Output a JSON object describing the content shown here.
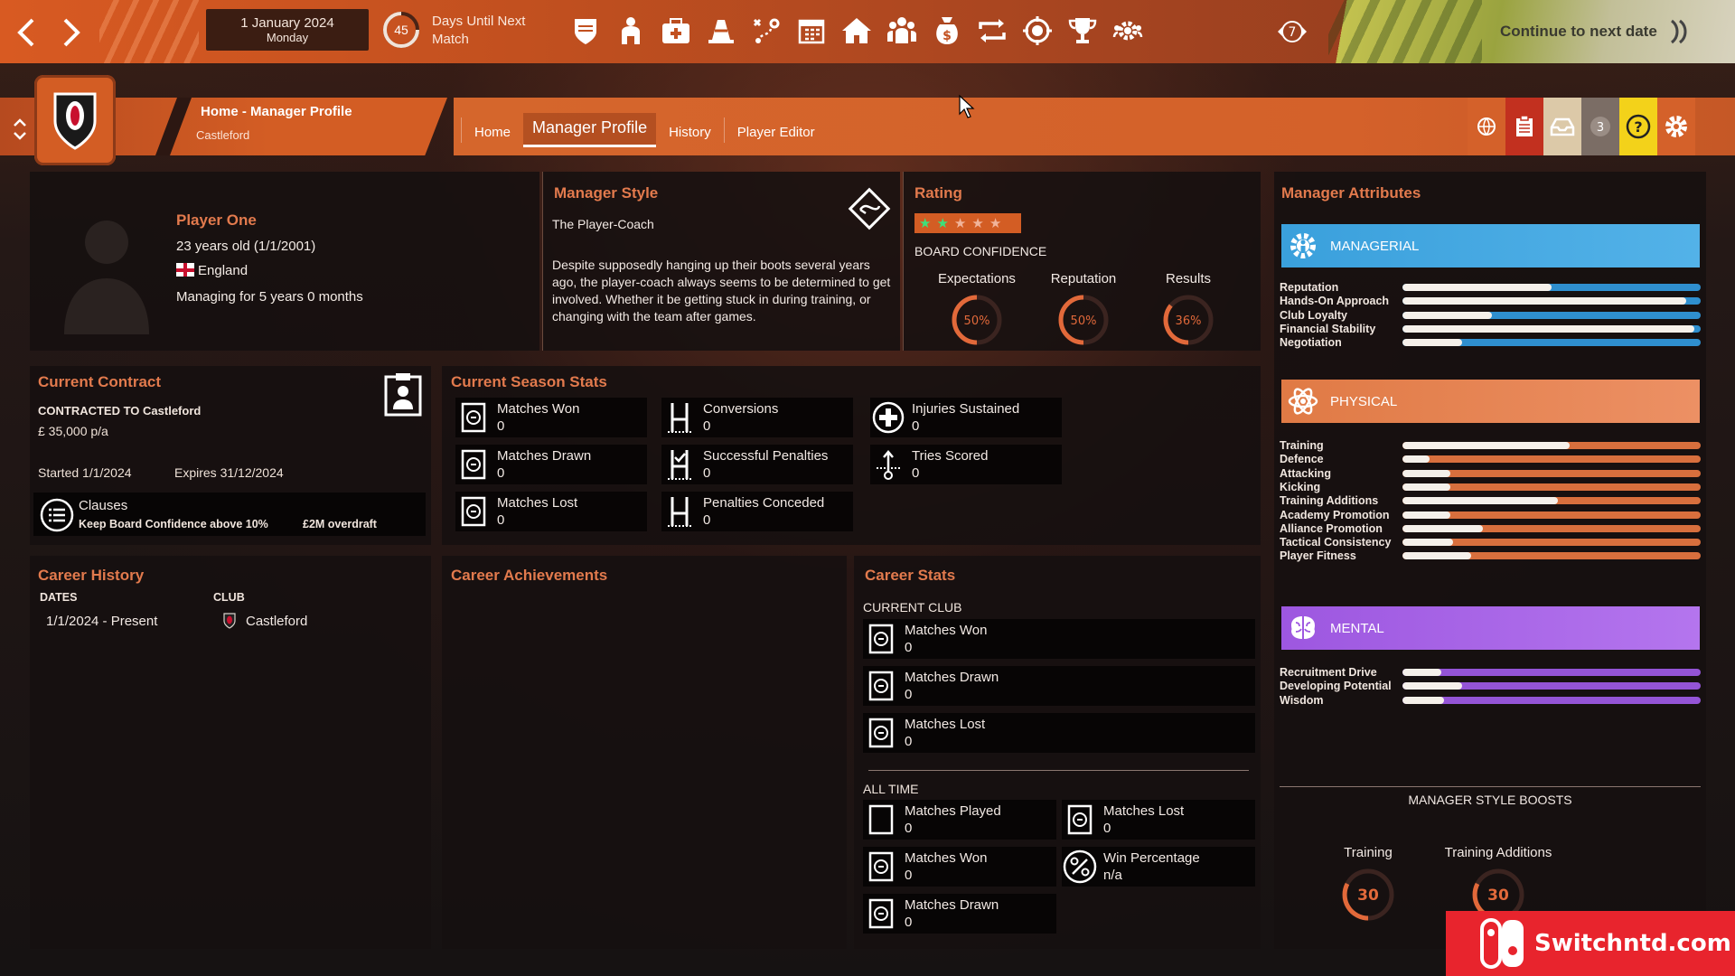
{
  "topbar": {
    "date": "1 January 2024",
    "weekday": "Monday",
    "days_count": "45",
    "days_label": "Days Until Next Match",
    "seven_badge": "7",
    "continue_label": "Continue to next date",
    "icons": [
      "shield-icon",
      "squad-icon",
      "medical-icon",
      "training-cone-icon",
      "tactics-icon",
      "calendar-icon",
      "home-icon",
      "staff-icon",
      "finance-icon",
      "transfer-icon",
      "scouting-icon",
      "trophy-icon",
      "settings-group-icon"
    ]
  },
  "breadcrumb": {
    "title": "Home - Manager Profile",
    "club": "Castleford"
  },
  "tabs": [
    "Home",
    "Manager Profile",
    "History",
    "Player Editor"
  ],
  "active_tab": "Manager Profile",
  "toolbar": {
    "notifications": "3"
  },
  "profile": {
    "name": "Player One",
    "age": "23 years old (1/1/2001)",
    "nation": "England",
    "tenure": "Managing for 5 years 0 months"
  },
  "manager_style": {
    "title": "Manager Style",
    "name": "The Player-Coach",
    "description": "Despite supposedly hanging up their boots several years ago, the player-coach always seems to be determined to get involved. Whether it be getting stuck in during training, or changing with the team after games."
  },
  "rating": {
    "title": "Rating",
    "stars_on": 2,
    "stars_total": 5,
    "board_confidence_label": "BOARD CONFIDENCE",
    "gauges": [
      {
        "label": "Expectations",
        "value": 50,
        "text": "50%"
      },
      {
        "label": "Reputation",
        "value": 50,
        "text": "50%"
      },
      {
        "label": "Results",
        "value": 36,
        "text": "36%"
      }
    ]
  },
  "contract": {
    "title": "Current Contract",
    "contracted_to": "CONTRACTED TO Castleford",
    "salary": "£ 35,000 p/a",
    "started_label": "Started",
    "started": "1/1/2024",
    "expires_label": "Expires",
    "expires": "31/12/2024",
    "clauses_label": "Clauses",
    "clause_1": "Keep Board Confidence above 10%",
    "clause_2": "£2M overdraft"
  },
  "season_stats": {
    "title": "Current Season Stats",
    "items": [
      {
        "label": "Matches Won",
        "value": "0"
      },
      {
        "label": "Conversions",
        "value": "0"
      },
      {
        "label": "Injuries Sustained",
        "value": "0"
      },
      {
        "label": "Matches Drawn",
        "value": "0"
      },
      {
        "label": "Successful Penalties",
        "value": "0"
      },
      {
        "label": "Tries Scored",
        "value": "0"
      },
      {
        "label": "Matches Lost",
        "value": "0"
      },
      {
        "label": "Penalties Conceded",
        "value": "0"
      }
    ]
  },
  "career_history": {
    "title": "Career History",
    "col_dates": "DATES",
    "col_club": "CLUB",
    "rows": [
      {
        "dates": "1/1/2024 - Present",
        "club": "Castleford"
      }
    ]
  },
  "career_achievements": {
    "title": "Career Achievements"
  },
  "career_stats": {
    "title": "Career Stats",
    "current_club_label": "CURRENT CLUB",
    "current": [
      {
        "label": "Matches Won",
        "value": "0"
      },
      {
        "label": "Matches Drawn",
        "value": "0"
      },
      {
        "label": "Matches Lost",
        "value": "0"
      }
    ],
    "all_time_label": "ALL TIME",
    "all_time": [
      {
        "label": "Matches Played",
        "value": "0"
      },
      {
        "label": "Matches Lost",
        "value": "0"
      },
      {
        "label": "Matches Won",
        "value": "0"
      },
      {
        "label": "Win Percentage",
        "value": "n/a"
      },
      {
        "label": "Matches Drawn",
        "value": "0"
      }
    ]
  },
  "attributes": {
    "title": "Manager Attributes",
    "managerial_label": "MANAGERIAL",
    "physical_label": "PHYSICAL",
    "mental_label": "MENTAL",
    "managerial": [
      {
        "name": "Reputation",
        "value": 0.5
      },
      {
        "name": "Hands-On Approach",
        "value": 0.95
      },
      {
        "name": "Club Loyalty",
        "value": 0.3
      },
      {
        "name": "Financial Stability",
        "value": 0.98
      },
      {
        "name": "Negotiation",
        "value": 0.2
      }
    ],
    "physical": [
      {
        "name": "Training",
        "value": 0.56
      },
      {
        "name": "Defence",
        "value": 0.09
      },
      {
        "name": "Attacking",
        "value": 0.16
      },
      {
        "name": "Kicking",
        "value": 0.16
      },
      {
        "name": "Training Additions",
        "value": 0.52
      },
      {
        "name": "Academy Promotion",
        "value": 0.16
      },
      {
        "name": "Alliance Promotion",
        "value": 0.27
      },
      {
        "name": "Tactical Consistency",
        "value": 0.17
      },
      {
        "name": "Player Fitness",
        "value": 0.23
      }
    ],
    "mental": [
      {
        "name": "Recruitment Drive",
        "value": 0.13
      },
      {
        "name": "Developing Potential",
        "value": 0.2
      },
      {
        "name": "Wisdom",
        "value": 0.14
      }
    ],
    "boosts_title": "MANAGER STYLE BOOSTS",
    "boosts": [
      {
        "label": "Training",
        "value": "30"
      },
      {
        "label": "Training Additions",
        "value": "30"
      }
    ]
  },
  "watermark": "Switchntd.com"
}
